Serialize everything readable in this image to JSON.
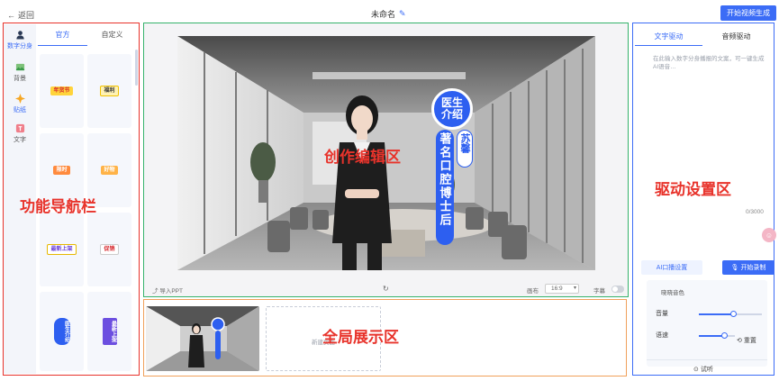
{
  "header": {
    "back_label": "返回",
    "title": "未命名",
    "generate_button": "开始视频生成"
  },
  "left_nav": {
    "side_items": [
      {
        "label": "数字分身",
        "icon": "person-icon"
      },
      {
        "label": "背景",
        "icon": "image-icon"
      },
      {
        "label": "贴纸",
        "icon": "sparkle-icon"
      },
      {
        "label": "文字",
        "icon": "text-icon"
      }
    ],
    "tabs": [
      "官方",
      "自定义"
    ],
    "stickers": [
      "年货节",
      "福利",
      "限时",
      "好物",
      "最新上架",
      "促销",
      "医生介绍",
      "最新上架"
    ],
    "region_label": "功能导航栏"
  },
  "editor": {
    "region_label": "创作编辑区",
    "badge_top": "医生介绍",
    "badge_name": "苏馨",
    "badge_desc": "著名口腔博士后",
    "toolbar": {
      "import_ppt": "导入PPT",
      "ratio_label": "画布",
      "ratio_value": "16:9",
      "subtitle_label": "字幕"
    }
  },
  "global": {
    "region_label": "全局展示区",
    "empty_text": "新建页面"
  },
  "drive": {
    "tabs": [
      "文字驱动",
      "音频驱动"
    ],
    "placeholder": "在此输入数字分身播报的文案，可一键生成AI语音…",
    "region_label": "驱动设置区",
    "char_count": "0/3000",
    "audio_button": "AI口播设置",
    "record_button": "开始录制",
    "voice_name": "晓晓音色",
    "volume_label": "音量",
    "speed_label": "语速",
    "volume": 0.55,
    "speed": 0.72,
    "reset_label": "重置",
    "listen_label": "试听"
  },
  "colors": {
    "accent": "#3b6cf6",
    "nav_border": "#e8332b",
    "edit_border": "#35b26b",
    "global_border": "#f0a05a"
  }
}
